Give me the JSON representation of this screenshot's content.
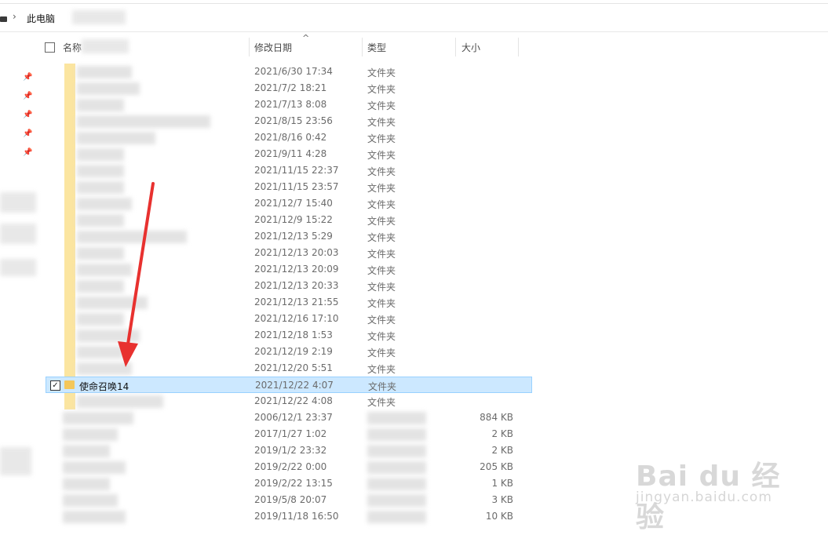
{
  "address_bar": {
    "separator": "›",
    "crumb": "此电脑"
  },
  "columns": {
    "name": "名称",
    "date": "修改日期",
    "type": "类型",
    "size": "大小",
    "sort_indicator": "^"
  },
  "rows": [
    {
      "date": "2021/6/30 17:34",
      "type": "文件夹",
      "size": ""
    },
    {
      "date": "2021/7/2 18:21",
      "type": "文件夹",
      "size": ""
    },
    {
      "date": "2021/7/13 8:08",
      "type": "文件夹",
      "size": ""
    },
    {
      "date": "2021/8/15 23:56",
      "type": "文件夹",
      "size": ""
    },
    {
      "date": "2021/8/16 0:42",
      "type": "文件夹",
      "size": ""
    },
    {
      "date": "2021/9/11 4:28",
      "type": "文件夹",
      "size": ""
    },
    {
      "date": "2021/11/15 22:37",
      "type": "文件夹",
      "size": ""
    },
    {
      "date": "2021/11/15 23:57",
      "type": "文件夹",
      "size": ""
    },
    {
      "date": "2021/12/7 15:40",
      "type": "文件夹",
      "size": ""
    },
    {
      "date": "2021/12/9 15:22",
      "type": "文件夹",
      "size": ""
    },
    {
      "date": "2021/12/13 5:29",
      "type": "文件夹",
      "size": ""
    },
    {
      "date": "2021/12/13 20:03",
      "type": "文件夹",
      "size": ""
    },
    {
      "date": "2021/12/13 20:09",
      "type": "文件夹",
      "size": ""
    },
    {
      "date": "2021/12/13 20:33",
      "type": "文件夹",
      "size": ""
    },
    {
      "date": "2021/12/13 21:55",
      "type": "文件夹",
      "size": ""
    },
    {
      "date": "2021/12/16 17:10",
      "type": "文件夹",
      "size": ""
    },
    {
      "date": "2021/12/18 1:53",
      "type": "文件夹",
      "size": ""
    },
    {
      "date": "2021/12/19 2:19",
      "type": "文件夹",
      "size": ""
    },
    {
      "date": "2021/12/20 5:51",
      "type": "文件夹",
      "size": ""
    },
    {
      "date": "2021/12/22 4:07",
      "type": "文件夹",
      "size": "",
      "name": "使命召唤14",
      "selected": true
    },
    {
      "date": "2021/12/22 4:08",
      "type": "文件夹",
      "size": ""
    },
    {
      "date": "2006/12/1 23:37",
      "type": "",
      "size": "884 KB"
    },
    {
      "date": "2017/1/27 1:02",
      "type": "",
      "size": "2 KB"
    },
    {
      "date": "2019/1/2 23:32",
      "type": "",
      "size": "2 KB"
    },
    {
      "date": "2019/2/22 0:00",
      "type": "",
      "size": "205 KB"
    },
    {
      "date": "2019/2/22 13:15",
      "type": "",
      "size": "1 KB"
    },
    {
      "date": "2019/5/8 20:07",
      "type": "",
      "size": "3 KB"
    },
    {
      "date": "2019/11/18 16:50",
      "type": "",
      "size": "10 KB"
    }
  ],
  "watermark": {
    "main": "Bai du 经验",
    "sub": "jingyan.baidu.com"
  },
  "colors": {
    "selection_bg": "#cce8ff",
    "selection_border": "#99d1ff",
    "folder": "#f3c75a",
    "arrow": "#e8312f"
  }
}
